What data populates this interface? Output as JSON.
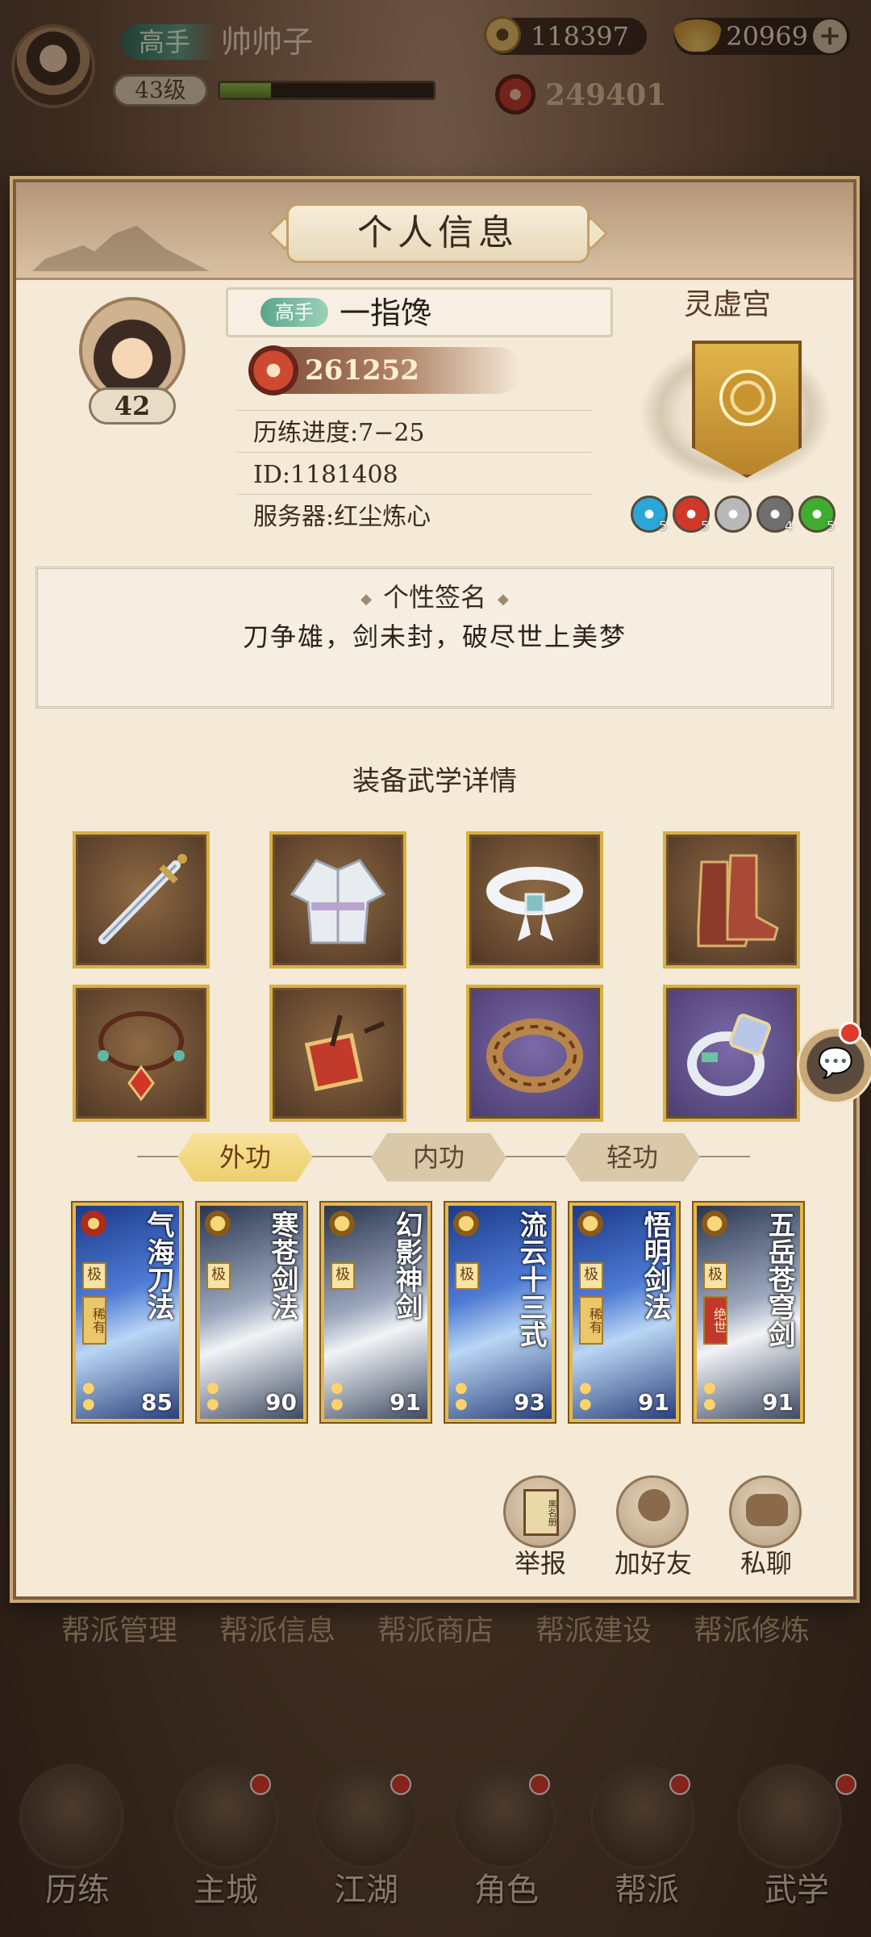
{
  "top_bar": {
    "rank": "高手",
    "player_name": "帅帅子",
    "level": "43级",
    "xp_fraction": 0.24,
    "coins": "118397",
    "gold_ingots": "20969",
    "combat_power": "249401"
  },
  "panel": {
    "title": "个人信息",
    "player": {
      "rank": "高手",
      "name": "一指馋",
      "level": "42",
      "combat_power": "261252",
      "progress": "历练进度:7−25",
      "id": "ID:1181408",
      "server": "服务器:红尘炼心"
    },
    "guild": {
      "name": "灵虚宫",
      "badges": [
        {
          "icon": "blue-element-badge-icon",
          "color": "#2aa7d6",
          "count": "5"
        },
        {
          "icon": "fire-element-badge-icon",
          "color": "#d0382a",
          "count": "5"
        },
        {
          "icon": "silver-element-badge-icon",
          "color": "#b8b8b8",
          "count": ""
        },
        {
          "icon": "dark-element-badge-icon",
          "color": "#707070",
          "count": "4"
        },
        {
          "icon": "green-element-badge-icon",
          "color": "#3fae2e",
          "count": "5"
        }
      ]
    },
    "signature": {
      "title": "个性签名",
      "text": "刀争雄，剑未封，破尽世上美梦"
    },
    "equipment": {
      "title": "装备武学详情",
      "slots": [
        {
          "icon": "sword-icon",
          "quality": "gold"
        },
        {
          "icon": "robe-icon",
          "quality": "gold"
        },
        {
          "icon": "belt-icon",
          "quality": "gold"
        },
        {
          "icon": "boots-icon",
          "quality": "gold"
        },
        {
          "icon": "necklace-icon",
          "quality": "gold"
        },
        {
          "icon": "amulet-icon",
          "quality": "gold"
        },
        {
          "icon": "bracelet-icon",
          "quality": "purple"
        },
        {
          "icon": "ring-icon",
          "quality": "purple"
        }
      ]
    },
    "tabs": [
      "外功",
      "内功",
      "轻功"
    ],
    "active_tab": "外功",
    "martial_arts": [
      {
        "name": "气海刀法",
        "value": "85",
        "grade": "极",
        "tag": "稀有"
      },
      {
        "name": "寒苍剑法",
        "value": "90",
        "grade": "极",
        "tag": ""
      },
      {
        "name": "幻影神剑",
        "value": "91",
        "grade": "极",
        "tag": ""
      },
      {
        "name": "流云十三式",
        "value": "93",
        "grade": "极",
        "tag": ""
      },
      {
        "name": "悟明剑法",
        "value": "91",
        "grade": "极",
        "tag": "稀有"
      },
      {
        "name": "五岳苍穹剑",
        "value": "91",
        "grade": "极",
        "tag": "绝世"
      }
    ],
    "actions": {
      "report": "举报",
      "add_friend": "加好友",
      "private_chat": "私聊",
      "report_book_label": "黑名册"
    }
  },
  "guild_menu": [
    "帮派管理",
    "帮派信息",
    "帮派商店",
    "帮派建设",
    "帮派修炼"
  ],
  "bottom_nav": [
    "历练",
    "主城",
    "江湖",
    "角色",
    "帮派",
    "武学"
  ]
}
